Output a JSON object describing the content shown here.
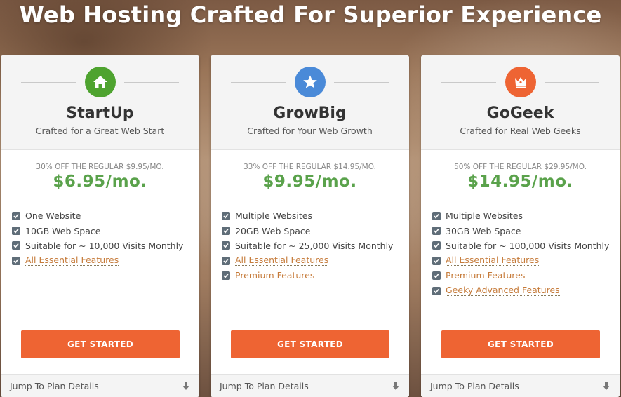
{
  "headline": "Web Hosting Crafted For Superior Experience",
  "colors": {
    "accent_button": "#ee6433",
    "price_green": "#5aa24b",
    "startup_badge": "#4ea32f",
    "growbig_badge": "#4a8ad8",
    "gogeek_badge": "#ee6433"
  },
  "plans": [
    {
      "icon": "house-icon",
      "name": "StartUp",
      "tagline": "Crafted for a Great Web Start",
      "regular": "30% OFF THE REGULAR $9.95/MO.",
      "price": "$6.95/mo.",
      "features": [
        "One Website",
        "10GB Web Space",
        "Suitable for ~ 10,000 Visits Monthly",
        "All Essential Features"
      ],
      "cta": "GET STARTED",
      "jump": "Jump To Plan Details"
    },
    {
      "icon": "star-icon",
      "name": "GrowBig",
      "tagline": "Crafted for Your Web Growth",
      "regular": "33% OFF THE REGULAR $14.95/MO.",
      "price": "$9.95/mo.",
      "features": [
        "Multiple Websites",
        "20GB Web Space",
        "Suitable for ~ 25,000 Visits Monthly",
        "All Essential Features",
        "Premium Features"
      ],
      "cta": "GET STARTED",
      "jump": "Jump To Plan Details"
    },
    {
      "icon": "crown-icon",
      "name": "GoGeek",
      "tagline": "Crafted for Real Web Geeks",
      "regular": "50% OFF THE REGULAR $29.95/MO.",
      "price": "$14.95/mo.",
      "features": [
        "Multiple Websites",
        "30GB Web Space",
        "Suitable for ~ 100,000 Visits Monthly",
        "All Essential Features",
        "Premium Features",
        "Geeky Advanced Features"
      ],
      "cta": "GET STARTED",
      "jump": "Jump To Plan Details"
    }
  ]
}
